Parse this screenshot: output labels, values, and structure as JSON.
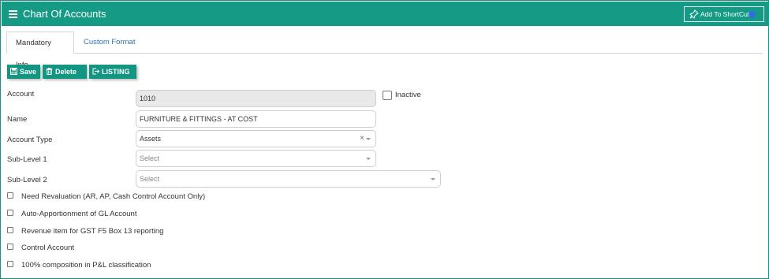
{
  "header": {
    "title": "Chart Of Accounts",
    "shortcut_label": "Add To ShortCut"
  },
  "tabs": [
    {
      "label": "Mandatory Info",
      "active": true
    },
    {
      "label": "Custom Format",
      "active": false
    }
  ],
  "toolbar": {
    "save_label": "Save",
    "delete_label": "Delete",
    "listing_label": "LISTING"
  },
  "form": {
    "account": {
      "label": "Account",
      "value": "1010"
    },
    "inactive": {
      "label": "Inactive",
      "checked": false
    },
    "name": {
      "label": "Name",
      "value": "FURNITURE & FITTINGS - AT COST"
    },
    "account_type": {
      "label": "Account Type",
      "value": "Assets",
      "clear": "×"
    },
    "sub_level_1": {
      "label": "Sub-Level 1",
      "placeholder": "Select"
    },
    "sub_level_2": {
      "label": "Sub-Level 2",
      "placeholder": "Select"
    }
  },
  "options": [
    {
      "label": "Need Revaluation (AR, AP, Cash Control Account Only)",
      "checked": false
    },
    {
      "label": "Auto-Apportionment of GL Account",
      "checked": false
    },
    {
      "label": "Revenue item for GST F5 Box 13 reporting",
      "checked": false
    },
    {
      "label": "Control Account",
      "checked": false
    },
    {
      "label": "100% composition in P&L classification",
      "checked": false
    }
  ],
  "colors": {
    "brand": "#159a85",
    "button": "#129682",
    "link": "#2a72b5"
  },
  "icons": {
    "menu": "hamburger-icon",
    "shortcut": "pin-icon",
    "save": "floppy-icon",
    "delete": "trash-icon",
    "listing": "export-icon"
  }
}
